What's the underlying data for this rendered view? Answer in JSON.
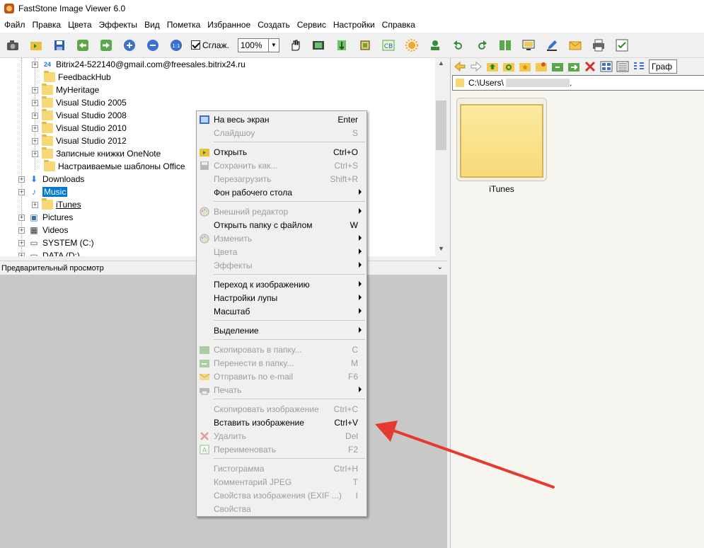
{
  "window": {
    "title": "FastStone Image Viewer 6.0"
  },
  "menubar": [
    "Файл",
    "Правка",
    "Цвета",
    "Эффекты",
    "Вид",
    "Пометка",
    "Избранное",
    "Создать",
    "Сервис",
    "Настройки",
    "Справка"
  ],
  "toolbar": {
    "smooth_label": "Сглаж.",
    "smooth_checked": true,
    "zoom_value": "100%"
  },
  "tree": {
    "items": [
      {
        "label": "Bitrix24-522140@gmail.com@freesales.bitrix24.ru",
        "icon": "bitrix24-icon"
      },
      {
        "label": "FeedbackHub",
        "icon": "folder-icon"
      },
      {
        "label": "MyHeritage",
        "icon": "folder-icon"
      },
      {
        "label": "Visual Studio 2005",
        "icon": "folder-icon"
      },
      {
        "label": "Visual Studio 2008",
        "icon": "folder-icon"
      },
      {
        "label": "Visual Studio 2010",
        "icon": "folder-icon"
      },
      {
        "label": "Visual Studio 2012",
        "icon": "folder-icon"
      },
      {
        "label": "Записные книжки OneNote",
        "icon": "folder-icon"
      },
      {
        "label": "Настраиваемые шаблоны Office",
        "icon": "folder-icon"
      },
      {
        "label": "Downloads",
        "icon": "download-arrow-icon"
      },
      {
        "label": "Music",
        "icon": "music-note-icon",
        "selected": true
      },
      {
        "label": "iTunes",
        "icon": "folder-icon"
      },
      {
        "label": "Pictures",
        "icon": "pictures-icon"
      },
      {
        "label": "Videos",
        "icon": "film-icon"
      },
      {
        "label": "SYSTEM (C:)",
        "icon": "drive-icon"
      },
      {
        "label": "DATA (D:)",
        "icon": "drive-icon"
      }
    ]
  },
  "preview": {
    "title": "Предварительный просмотр"
  },
  "right": {
    "path_prefix": "C:\\Users\\",
    "path_suffix": ".",
    "view_combo": "Граф",
    "thumbnail_label": "iTunes"
  },
  "context_menu": {
    "items": [
      {
        "label": "На весь экран",
        "shortcut": "Enter",
        "enabled": true,
        "icon": "fullscreen-icon"
      },
      {
        "label": "Слайдшоу",
        "shortcut": "S",
        "enabled": false
      },
      {
        "sep": true
      },
      {
        "label": "Открыть",
        "shortcut": "Ctrl+O",
        "enabled": true,
        "icon": "open-folder-icon"
      },
      {
        "label": "Сохранить как...",
        "shortcut": "Ctrl+S",
        "enabled": false,
        "icon": "save-icon"
      },
      {
        "label": "Перезагрузить",
        "shortcut": "Shift+R",
        "enabled": false
      },
      {
        "label": "Фон рабочего стола",
        "submenu": true,
        "enabled": true
      },
      {
        "sep": true
      },
      {
        "label": "Внешний редактор",
        "submenu": true,
        "enabled": false,
        "icon": "palette-icon"
      },
      {
        "label": "Открыть папку с файлом",
        "shortcut": "W",
        "enabled": true
      },
      {
        "label": "Изменить",
        "submenu": true,
        "enabled": false,
        "icon": "palette-icon"
      },
      {
        "label": "Цвета",
        "submenu": true,
        "enabled": false
      },
      {
        "label": "Эффекты",
        "submenu": true,
        "enabled": false
      },
      {
        "sep": true
      },
      {
        "label": "Переход к изображению",
        "submenu": true,
        "enabled": true
      },
      {
        "label": "Настройки лупы",
        "submenu": true,
        "enabled": true
      },
      {
        "label": "Масштаб",
        "submenu": true,
        "enabled": true
      },
      {
        "sep": true
      },
      {
        "label": "Выделение",
        "submenu": true,
        "enabled": true
      },
      {
        "sep": true
      },
      {
        "label": "Скопировать в папку...",
        "shortcut": "C",
        "enabled": false,
        "icon": "copy-folder-icon"
      },
      {
        "label": "Перенести в папку...",
        "shortcut": "M",
        "enabled": false,
        "icon": "move-folder-icon"
      },
      {
        "label": "Отправить по e-mail",
        "shortcut": "F6",
        "enabled": false,
        "icon": "email-icon"
      },
      {
        "label": "Печать",
        "submenu": true,
        "enabled": false,
        "icon": "printer-icon"
      },
      {
        "sep": true
      },
      {
        "label": "Скопировать изображение",
        "shortcut": "Ctrl+C",
        "enabled": false
      },
      {
        "label": "Вставить изображение",
        "shortcut": "Ctrl+V",
        "enabled": true
      },
      {
        "label": "Удалить",
        "shortcut": "Del",
        "enabled": false,
        "icon": "delete-x-icon"
      },
      {
        "label": "Переименовать",
        "shortcut": "F2",
        "enabled": false,
        "icon": "rename-icon"
      },
      {
        "sep": true
      },
      {
        "label": "Гистограмма",
        "shortcut": "Ctrl+H",
        "enabled": false
      },
      {
        "label": "Комментарий JPEG",
        "shortcut": "T",
        "enabled": false
      },
      {
        "label": "Свойства изображения (EXIF ...)",
        "shortcut": "I",
        "enabled": false
      },
      {
        "label": "Свойства",
        "enabled": false
      }
    ]
  },
  "colors": {
    "selection": "#0078d7",
    "annotation_arrow": "#e53a2f",
    "folder": "#f8d775"
  }
}
